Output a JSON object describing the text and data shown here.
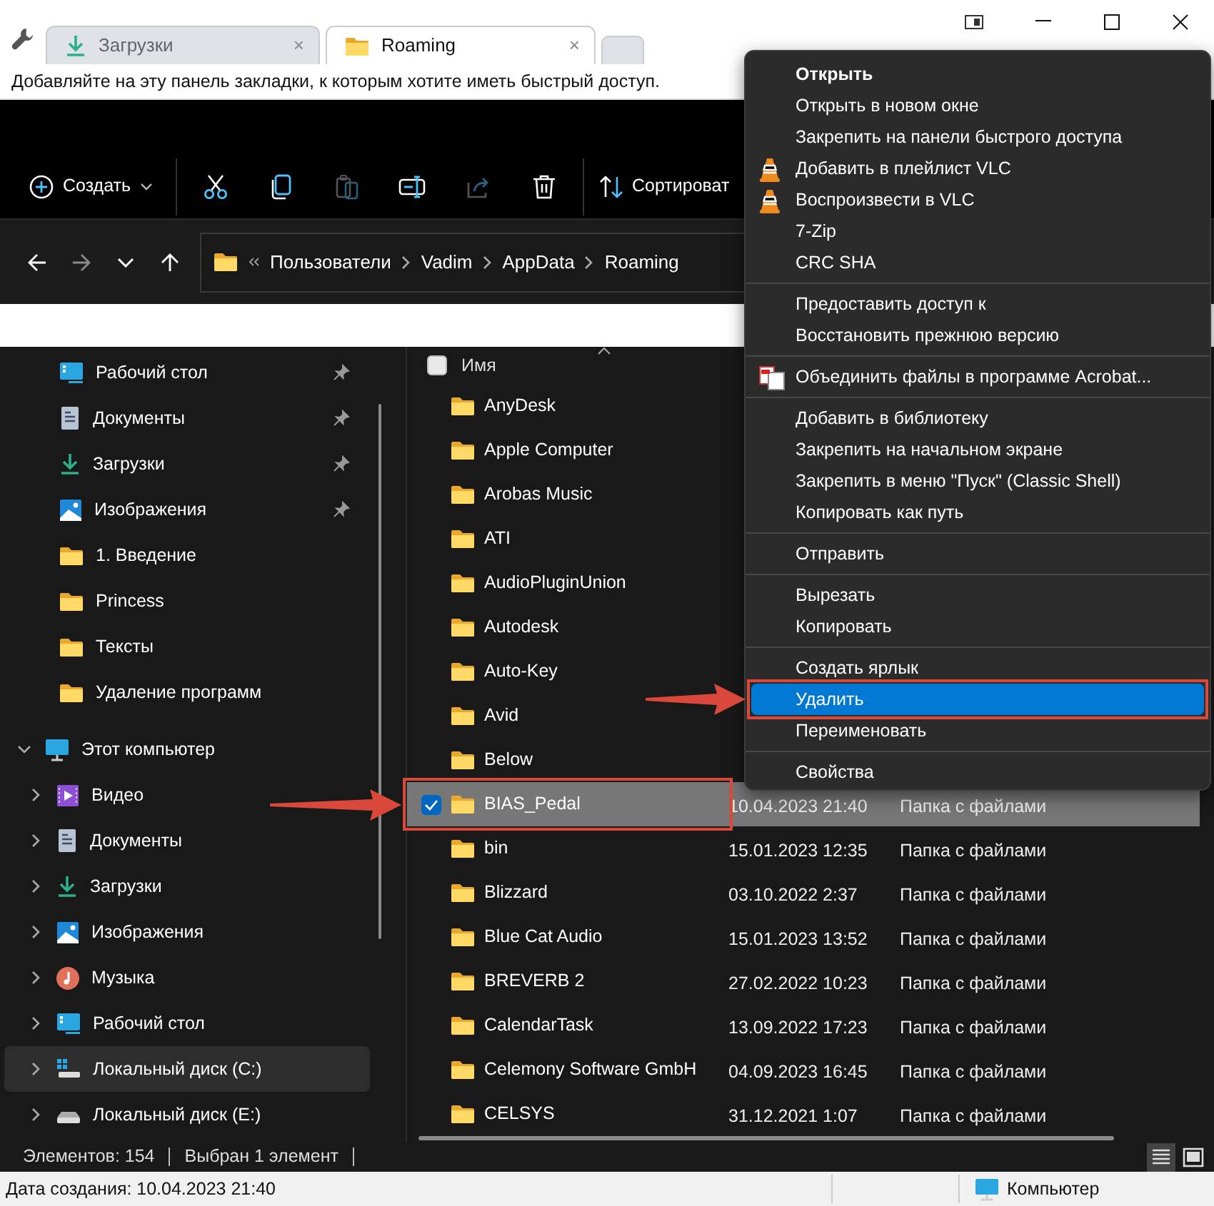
{
  "browser": {
    "tabs": [
      {
        "label": "Загрузки",
        "kind": "download",
        "close": "×",
        "selected": false
      },
      {
        "label": "Roaming",
        "kind": "folder",
        "close": "×",
        "selected": true
      }
    ],
    "bookmarks_hint": "Добавляйте на эту панель закладки, к которым хотите иметь быстрый доступ."
  },
  "toolbar": {
    "create": "Создать",
    "actions": [
      {
        "kind": "cut",
        "disabled": false
      },
      {
        "kind": "copy",
        "disabled": false
      },
      {
        "kind": "paste",
        "disabled": true
      },
      {
        "kind": "rename",
        "disabled": false
      },
      {
        "kind": "share",
        "disabled": true
      },
      {
        "kind": "delete",
        "disabled": false
      }
    ],
    "sort": "Сортироват"
  },
  "address_bar": {
    "nav": [
      {
        "kind": "back",
        "disabled": false
      },
      {
        "kind": "forward",
        "disabled": true
      },
      {
        "kind": "recent",
        "disabled": false
      },
      {
        "kind": "up",
        "disabled": false
      }
    ],
    "segments": [
      "Пользователи",
      "Vadim",
      "AppData",
      "Roaming"
    ]
  },
  "sidebar": {
    "items": [
      {
        "label": "Рабочий стол",
        "kind": "desktop",
        "pinned": true,
        "selected": false
      },
      {
        "label": "Документы",
        "kind": "documents",
        "pinned": true,
        "selected": false
      },
      {
        "label": "Загрузки",
        "kind": "download",
        "pinned": true,
        "selected": false
      },
      {
        "label": "Изображения",
        "kind": "pictures",
        "pinned": true,
        "selected": false
      },
      {
        "label": "1. Введение",
        "kind": "folder",
        "pinned": false,
        "selected": false
      },
      {
        "label": "Princess",
        "kind": "folder",
        "pinned": false,
        "selected": false
      },
      {
        "label": "Тексты",
        "kind": "folder",
        "pinned": false,
        "selected": false
      },
      {
        "label": "Удаление программ",
        "kind": "folder",
        "pinned": false,
        "selected": false
      }
    ],
    "this_pc": {
      "label": "Этот компьютер",
      "expanded": true,
      "children": [
        {
          "label": "Видео",
          "kind": "video",
          "expanded": false,
          "selected": false
        },
        {
          "label": "Документы",
          "kind": "documents",
          "expanded": false,
          "selected": false
        },
        {
          "label": "Загрузки",
          "kind": "download",
          "expanded": false,
          "selected": false
        },
        {
          "label": "Изображения",
          "kind": "pictures",
          "expanded": false,
          "selected": false
        },
        {
          "label": "Музыка",
          "kind": "music",
          "expanded": false,
          "selected": false
        },
        {
          "label": "Рабочий стол",
          "kind": "desktop",
          "expanded": false,
          "selected": false
        },
        {
          "label": "Локальный диск (C:)",
          "kind": "system_drive",
          "expanded": false,
          "selected": true
        },
        {
          "label": "Локальный диск (E:)",
          "kind": "drive",
          "expanded": false,
          "selected": false
        }
      ]
    }
  },
  "file_list": {
    "header": {
      "label": "Имя",
      "checked": false
    },
    "rows": [
      {
        "name": "AnyDesk",
        "selected": false,
        "callout": false
      },
      {
        "name": "Apple Computer",
        "selected": false,
        "callout": false
      },
      {
        "name": "Arobas Music",
        "selected": false,
        "callout": false
      },
      {
        "name": "ATI",
        "selected": false,
        "callout": false
      },
      {
        "name": "AudioPluginUnion",
        "selected": false,
        "callout": false
      },
      {
        "name": "Autodesk",
        "selected": false,
        "callout": false
      },
      {
        "name": "Auto-Key",
        "selected": false,
        "callout": false
      },
      {
        "name": "Avid",
        "selected": false,
        "callout": false
      },
      {
        "name": "Below",
        "selected": false,
        "callout": false
      },
      {
        "name": "BIAS_Pedal",
        "date": "10.04.2023 21:40",
        "type": "Папка с файлами",
        "selected": true,
        "callout": true
      },
      {
        "name": "bin",
        "date": "15.01.2023 12:35",
        "type": "Папка с файлами",
        "selected": false,
        "callout": false
      },
      {
        "name": "Blizzard",
        "date": "03.10.2022 2:37",
        "type": "Папка с файлами",
        "selected": false,
        "callout": false
      },
      {
        "name": "Blue Cat Audio",
        "date": "15.01.2023 13:52",
        "type": "Папка с файлами",
        "selected": false,
        "callout": false
      },
      {
        "name": "BREVERB 2",
        "date": "27.02.2022 10:23",
        "type": "Папка с файлами",
        "selected": false,
        "callout": false
      },
      {
        "name": "CalendarTask",
        "date": "13.09.2022 17:23",
        "type": "Папка с файлами",
        "selected": false,
        "callout": false
      },
      {
        "name": "Celemony Software GmbH",
        "date": "04.09.2023 16:45",
        "type": "Папка с файлами",
        "selected": false,
        "callout": false
      },
      {
        "name": "CELSYS",
        "date": "31.12.2021 1:07",
        "type": "Папка с файлами",
        "selected": false,
        "callout": false
      }
    ]
  },
  "context_menu": {
    "groups": [
      {
        "items": [
          {
            "label": "Открыть",
            "bold": true,
            "selected": false
          },
          {
            "label": "Открыть в новом окне",
            "selected": false
          },
          {
            "label": "Закрепить на панели быстрого доступа",
            "selected": false
          },
          {
            "label": "Добавить в плейлист VLC",
            "kind": "vlc",
            "selected": false
          },
          {
            "label": "Воспроизвести в VLC",
            "kind": "vlc",
            "selected": false
          },
          {
            "label": "7-Zip",
            "selected": false
          },
          {
            "label": "CRC SHA",
            "selected": false
          }
        ]
      },
      {
        "items": [
          {
            "label": "Предоставить доступ к",
            "selected": false
          },
          {
            "label": "Восстановить прежнюю версию",
            "selected": false
          }
        ]
      },
      {
        "items": [
          {
            "label": "Объединить файлы в программе Acrobat...",
            "kind": "acrobat",
            "selected": false
          }
        ]
      },
      {
        "items": [
          {
            "label": "Добавить в библиотеку",
            "selected": false
          },
          {
            "label": "Закрепить на начальном экране",
            "selected": false
          },
          {
            "label": "Закрепить в меню \"Пуск\" (Classic Shell)",
            "selected": false
          },
          {
            "label": "Копировать как путь",
            "selected": false
          }
        ]
      },
      {
        "items": [
          {
            "label": "Отправить",
            "selected": false
          }
        ]
      },
      {
        "items": [
          {
            "label": "Вырезать",
            "selected": false
          },
          {
            "label": "Копировать",
            "selected": false
          }
        ]
      },
      {
        "items": [
          {
            "label": "Создать ярлык",
            "selected": false
          },
          {
            "label": "Удалить",
            "selected": true,
            "callout": true
          },
          {
            "label": "Переименовать",
            "selected": false
          }
        ]
      },
      {
        "items": [
          {
            "label": "Свойства",
            "selected": false
          }
        ]
      }
    ]
  },
  "status_bar": {
    "items_count": "Элементов: 154",
    "selection": "Выбран 1 элемент",
    "view_buttons": [
      {
        "kind": "details",
        "selected": true
      },
      {
        "kind": "tiles",
        "selected": false
      }
    ]
  },
  "details_bar": {
    "created": "Дата создания: 10.04.2023 21:40",
    "location": "Компьютер"
  }
}
